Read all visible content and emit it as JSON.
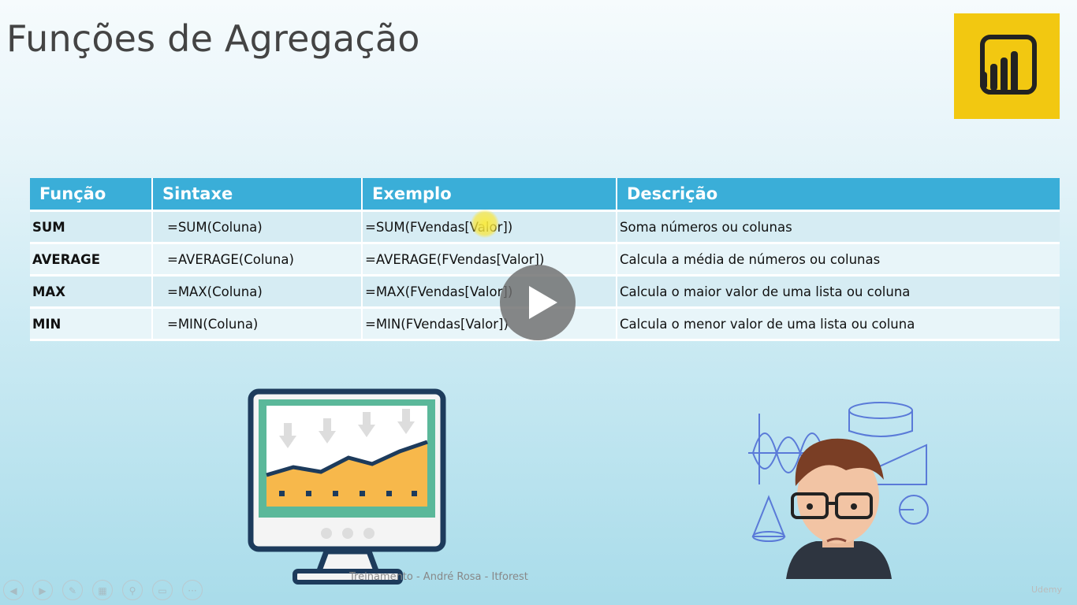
{
  "slide": {
    "title": "Funções de Agregação"
  },
  "table": {
    "headers": [
      "Função",
      "Sintaxe",
      "Exemplo",
      "Descrição"
    ],
    "rows": [
      {
        "func": "SUM",
        "syntax": "=SUM(Coluna)",
        "example": "=SUM(FVendas[Valor])",
        "description": "Soma números ou colunas"
      },
      {
        "func": "AVERAGE",
        "syntax": "=AVERAGE(Coluna)",
        "example": "=AVERAGE(FVendas[Valor])",
        "description": "Calcula a média de números ou colunas"
      },
      {
        "func": "MAX",
        "syntax": "=MAX(Coluna)",
        "example": "=MAX(FVendas[Valor])",
        "description": "Calcula o maior valor de uma lista ou coluna"
      },
      {
        "func": "MIN",
        "syntax": "=MIN(Coluna)",
        "example": "=MIN(FVendas[Valor])",
        "description": "Calcula o menor valor de uma lista ou coluna"
      }
    ]
  },
  "footer": {
    "text": "Treinamento - André Rosa - Itforest"
  },
  "controls": [
    "previous-icon",
    "next-icon",
    "pen-icon",
    "slides-icon",
    "zoom-icon",
    "screen-icon",
    "more-icon"
  ],
  "branding": {
    "udemy": "Udemy",
    "accent": "#3aaed8",
    "logo_color": "#f2c811"
  }
}
